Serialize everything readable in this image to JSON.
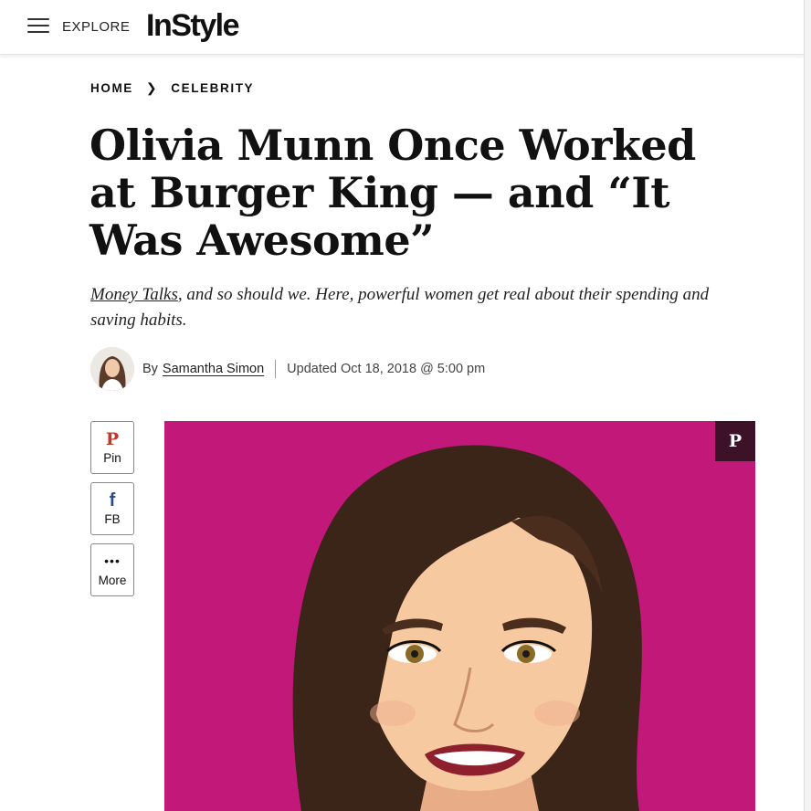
{
  "header": {
    "menu_icon": "hamburger-icon",
    "explore_label": "EXPLORE",
    "logo_text": "InStyle"
  },
  "breadcrumb": {
    "items": [
      "HOME",
      "CELEBRITY"
    ],
    "separator_icon": "chevron-right-icon"
  },
  "article": {
    "title": "Olivia Munn Once Worked at Burger King — and “It Was Awesome”",
    "subtitle_link": "Money Talks",
    "subtitle_rest": ", and so should we. Here, powerful women get real about their spending and saving habits.",
    "byline_prefix": "By",
    "author": "Samantha Simon",
    "updated": "Updated Oct 18, 2018 @ 5:00 pm"
  },
  "share": {
    "buttons": [
      {
        "label": "Pin",
        "icon": "pinterest-icon"
      },
      {
        "label": "FB",
        "icon": "facebook-icon"
      },
      {
        "label": "More",
        "icon": "more-dots-icon"
      }
    ]
  },
  "hero": {
    "background_color": "#c2187a",
    "pin_icon": "pinterest-icon"
  },
  "colors": {
    "pinterest": "#c0392b",
    "facebook": "#2b4c8c",
    "hero_bg": "#c2187a",
    "pin_overlay": "#3d1128"
  }
}
